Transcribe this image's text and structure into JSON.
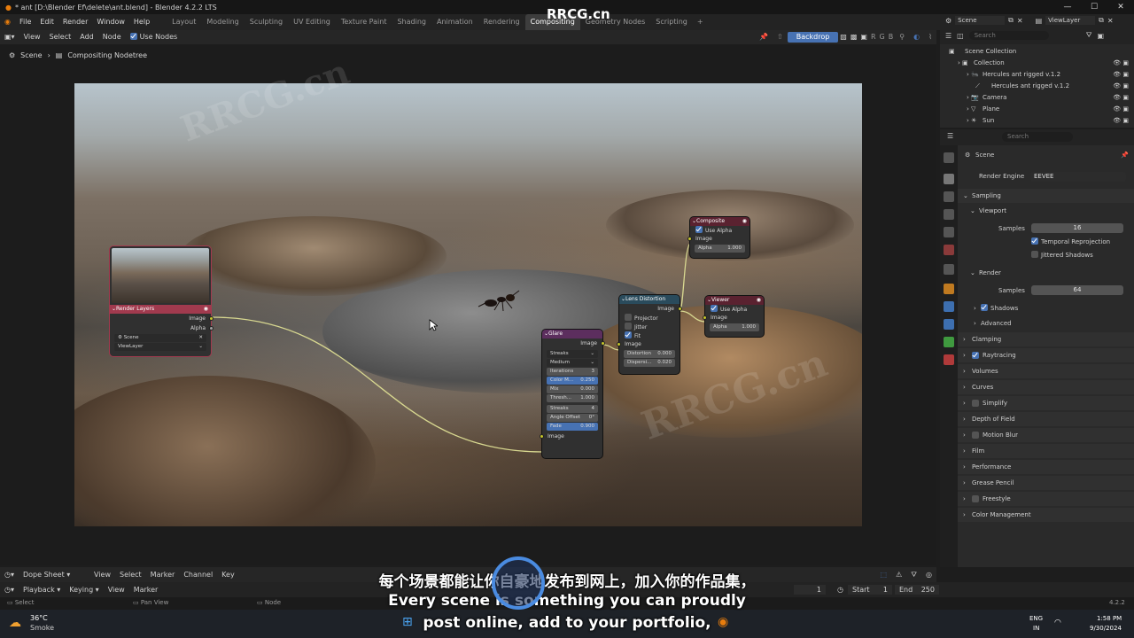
{
  "window": {
    "title": "* ant [D:\\Blender Ef\\delete\\ant.blend] - Blender 4.2.2 LTS",
    "controls": [
      "—",
      "☐",
      "✕"
    ]
  },
  "menus": [
    "File",
    "Edit",
    "Render",
    "Window",
    "Help"
  ],
  "workspaces": [
    {
      "label": "Layout",
      "active": false
    },
    {
      "label": "Modeling",
      "active": false
    },
    {
      "label": "Sculpting",
      "active": false
    },
    {
      "label": "UV Editing",
      "active": false
    },
    {
      "label": "Texture Paint",
      "active": false
    },
    {
      "label": "Shading",
      "active": false
    },
    {
      "label": "Animation",
      "active": false
    },
    {
      "label": "Rendering",
      "active": false
    },
    {
      "label": "Compositing",
      "active": true
    },
    {
      "label": "Geometry Nodes",
      "active": false
    },
    {
      "label": "Scripting",
      "active": false
    }
  ],
  "scene_selector": {
    "scene": "Scene",
    "view_layer": "ViewLayer"
  },
  "node_editor": {
    "menus": [
      "View",
      "Select",
      "Add",
      "Node"
    ],
    "use_nodes_label": "Use Nodes",
    "backdrop_label": "Backdrop",
    "channel_buttons": [
      "R",
      "G",
      "B"
    ],
    "breadcrumb": [
      "Scene",
      "Compositing Nodetree"
    ]
  },
  "nodes": {
    "render_layers": {
      "title": "Render Layers",
      "outputs": [
        "Image",
        "Alpha"
      ],
      "scene": "Scene",
      "view_layer": "ViewLayer"
    },
    "glare": {
      "title": "Glare",
      "output": "Image",
      "type": "Streaks",
      "quality": "Medium",
      "fields": [
        {
          "label": "Iterations",
          "value": "3",
          "blue": false
        },
        {
          "label": "Color M...",
          "value": "0.250",
          "blue": true
        },
        {
          "label": "Mix",
          "value": "0.000",
          "blue": false
        },
        {
          "label": "Thresh...",
          "value": "1.000",
          "blue": false
        },
        {
          "label": "Streaks",
          "value": "4",
          "blue": false
        },
        {
          "label": "Angle Offset",
          "value": "0°",
          "blue": false
        },
        {
          "label": "Fade",
          "value": "0.900",
          "blue": true
        }
      ],
      "input": "Image"
    },
    "lens_distortion": {
      "title": "Lens Distortion",
      "output": "Image",
      "options": [
        {
          "label": "Projector",
          "checked": false
        },
        {
          "label": "Jitter",
          "checked": false
        },
        {
          "label": "Fit",
          "checked": true
        }
      ],
      "input": "Image",
      "fields": [
        {
          "label": "Distortion",
          "value": "0.000"
        },
        {
          "label": "Dispersi...",
          "value": "0.020"
        }
      ]
    },
    "composite": {
      "title": "Composite",
      "use_alpha": "Use Alpha",
      "input": "Image",
      "alpha_label": "Alpha",
      "alpha_value": "1.000"
    },
    "viewer": {
      "title": "Viewer",
      "use_alpha": "Use Alpha",
      "input": "Image",
      "alpha_label": "Alpha",
      "alpha_value": "1.000"
    }
  },
  "outliner": {
    "search_placeholder": "Search",
    "items": [
      {
        "label": "Scene Collection",
        "indent": 0
      },
      {
        "label": "Collection",
        "indent": 1
      },
      {
        "label": "Hercules ant rigged v.1.2",
        "indent": 2
      },
      {
        "label": "Hercules ant rigged v.1.2",
        "indent": 3
      },
      {
        "label": "Camera",
        "indent": 2
      },
      {
        "label": "Plane",
        "indent": 2
      },
      {
        "label": "Sun",
        "indent": 2
      }
    ]
  },
  "properties": {
    "search_placeholder": "Search",
    "context": "Scene",
    "render_engine_label": "Render Engine",
    "render_engine": "EEVEE",
    "sampling": "Sampling",
    "viewport": "Viewport",
    "samples_label": "Samples",
    "viewport_samples": "16",
    "temporal_reprojection": "Temporal Reprojection",
    "jittered_shadows": "Jittered Shadows",
    "render": "Render",
    "render_samples": "64",
    "shadows": "Shadows",
    "advanced": "Advanced",
    "panels": [
      "Clamping",
      "Raytracing",
      "Volumes",
      "Curves",
      "Simplify",
      "Depth of Field",
      "Motion Blur",
      "Film",
      "Performance",
      "Grease Pencil",
      "Freestyle",
      "Color Management"
    ]
  },
  "timeline": {
    "editor": "Dope Sheet",
    "menus": [
      "View",
      "Select",
      "Marker",
      "Channel",
      "Key"
    ],
    "playback": "Playback",
    "keying": "Keying",
    "view": "View",
    "marker": "Marker",
    "current_frame": "1",
    "start_label": "Start",
    "start": "1",
    "end_label": "End",
    "end": "250"
  },
  "statusbar": {
    "select": "Select",
    "pan_view": "Pan View",
    "node": "Node",
    "version": "4.2.2"
  },
  "taskbar": {
    "temp": "36°C",
    "weather": "Smoke",
    "lang": "ENG",
    "region": "IN",
    "time": "1:58 PM",
    "date": "9/30/2024"
  },
  "subtitles": {
    "chinese": "每个场景都能让你自豪地发布到网上，加入你的作品集，",
    "english_1": "Every scene is something you can proudly",
    "english_2": "post online, add to your portfolio,"
  },
  "watermark": "RRCG.cn",
  "colors": {
    "accent_blue": "#4772b3",
    "active_tab": "#3d3d3d",
    "render_layers_header": "#a13a4e",
    "glare_header": "#5c2e5e",
    "lens_header": "#2a4b5c",
    "output_header": "#5a2230",
    "socket_yellow": "#c7c729"
  }
}
